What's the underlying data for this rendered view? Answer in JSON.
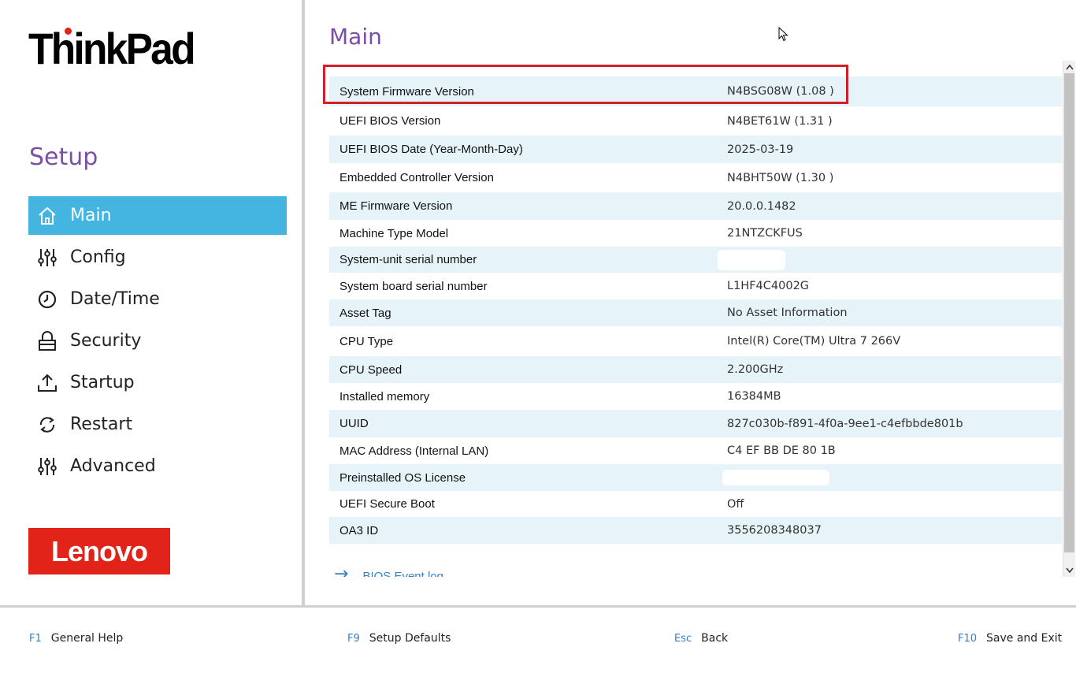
{
  "sidebar": {
    "brand": "ThinkPad",
    "setup_title": "Setup",
    "items": [
      {
        "label": "Main",
        "icon": "home-icon",
        "active": true
      },
      {
        "label": "Config",
        "icon": "sliders-icon"
      },
      {
        "label": "Date/Time",
        "icon": "clock-icon"
      },
      {
        "label": "Security",
        "icon": "lock-icon"
      },
      {
        "label": "Startup",
        "icon": "upload-icon"
      },
      {
        "label": "Restart",
        "icon": "restart-icon"
      },
      {
        "label": "Advanced",
        "icon": "sliders-icon"
      }
    ],
    "vendor": "Lenovo"
  },
  "main": {
    "title": "Main",
    "rows": [
      {
        "label": "System Firmware Version",
        "value": "N4BSG08W (1.08 )"
      },
      {
        "label": "UEFI BIOS Version",
        "value": "N4BET61W (1.31 )"
      },
      {
        "label": "UEFI BIOS Date (Year-Month-Day)",
        "value": "2025-03-19"
      },
      {
        "label": "Embedded Controller Version",
        "value": "N4BHT50W (1.30 )"
      },
      {
        "label": "ME Firmware Version",
        "value": "20.0.0.1482"
      },
      {
        "label": "Machine Type Model",
        "value": "21NTZCKFUS"
      },
      {
        "label": "System-unit serial number",
        "value": ""
      },
      {
        "label": "System board serial number",
        "value": "L1HF4C4002G"
      },
      {
        "label": "Asset Tag",
        "value": "No Asset Information"
      },
      {
        "label": "CPU Type",
        "value": "Intel(R) Core(TM) Ultra 7 266V"
      },
      {
        "label": "CPU Speed",
        "value": "2.200GHz"
      },
      {
        "label": "Installed memory",
        "value": "16384MB"
      },
      {
        "label": "UUID",
        "value": "827c030b-f891-4f0a-9ee1-c4efbbde801b"
      },
      {
        "label": "MAC Address (Internal LAN)",
        "value": "C4 EF BB DE 80 1B"
      },
      {
        "label": "Preinstalled OS License",
        "value": ""
      },
      {
        "label": "UEFI Secure Boot",
        "value": "Off"
      },
      {
        "label": "OA3 ID",
        "value": "3556208348037"
      }
    ],
    "event_log_label": "BIOS Event log"
  },
  "footer": [
    {
      "key": "F1",
      "label": "General Help"
    },
    {
      "key": "F9",
      "label": "Setup Defaults"
    },
    {
      "key": "Esc",
      "label": "Back"
    },
    {
      "key": "F10",
      "label": "Save and Exit"
    }
  ],
  "colors": {
    "accent": "#43b5e0",
    "title_purple": "#7b4fa8",
    "row_alt": "#e6f4fa",
    "highlight_red": "#d1202a",
    "lenovo_red": "#e2231a",
    "key_blue": "#3a7fc4"
  }
}
